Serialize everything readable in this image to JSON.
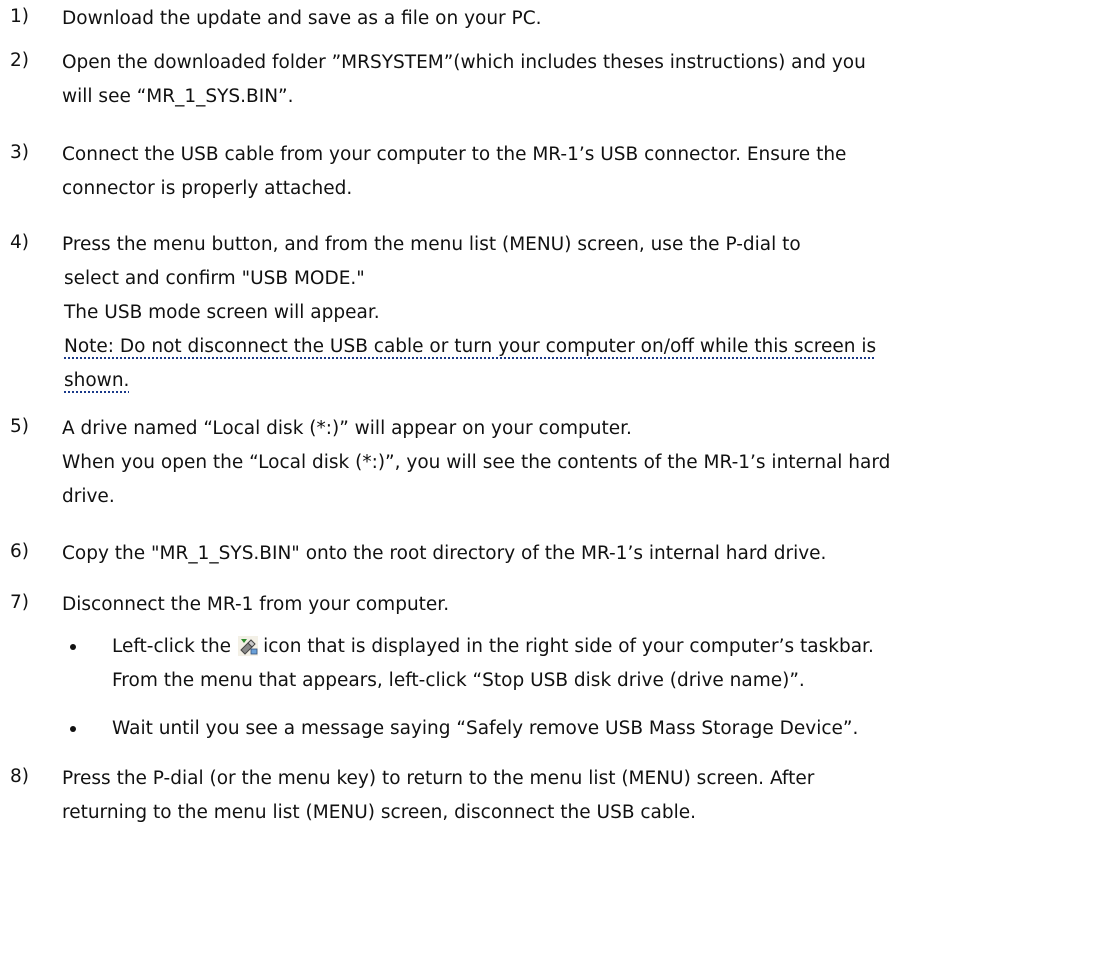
{
  "steps": [
    {
      "number": "1)",
      "lines": [
        "Download the update and save as a file on your PC."
      ]
    },
    {
      "number": "2)",
      "lines": [
        "Open the downloaded folder ”MRSYSTEM”(which includes theses instructions) and you",
        "will see “MR_1_SYS.BIN”."
      ]
    },
    {
      "number": "3)",
      "lines": [
        "Connect the USB cable from your computer to the MR-1’s USB connector. Ensure the",
        "connector is properly attached."
      ]
    },
    {
      "number": "4)",
      "lines": [
        "Press the menu button, and from the menu list (MENU) screen, use the P-dial to",
        "select and confirm \"USB MODE.\"",
        "The USB mode screen will appear."
      ],
      "note_lines": [
        "Note: Do not disconnect the USB cable or turn your computer on/off while this screen is",
        "shown."
      ]
    },
    {
      "number": "5)",
      "lines": [
        "A drive named “Local disk (*:)” will appear on your computer.",
        "When you open the “Local disk (*:)”, you will see the contents of the MR-1’s internal hard",
        "drive."
      ]
    },
    {
      "number": "6)",
      "lines": [
        "Copy the \"MR_1_SYS.BIN\" onto the root directory of the MR-1’s internal hard drive."
      ]
    },
    {
      "number": "7)",
      "lines": [
        "Disconnect the MR-1 from your computer."
      ],
      "bullets": [
        {
          "before_icon": "Left-click the",
          "icon": "usb-safely-remove-icon",
          "after_icon": "icon that is displayed in the right side of your computer’s taskbar.",
          "line2": "From the menu that appears, left-click “Stop USB disk drive (drive name)”."
        },
        {
          "text": "Wait until you see a message saying “Safely remove USB Mass Storage Device”."
        }
      ]
    },
    {
      "number": "8)",
      "lines": [
        "Press the P-dial (or the menu key) to return to the menu list (MENU) screen. After",
        "returning to the menu list (MENU) screen, disconnect the USB cable."
      ]
    }
  ]
}
